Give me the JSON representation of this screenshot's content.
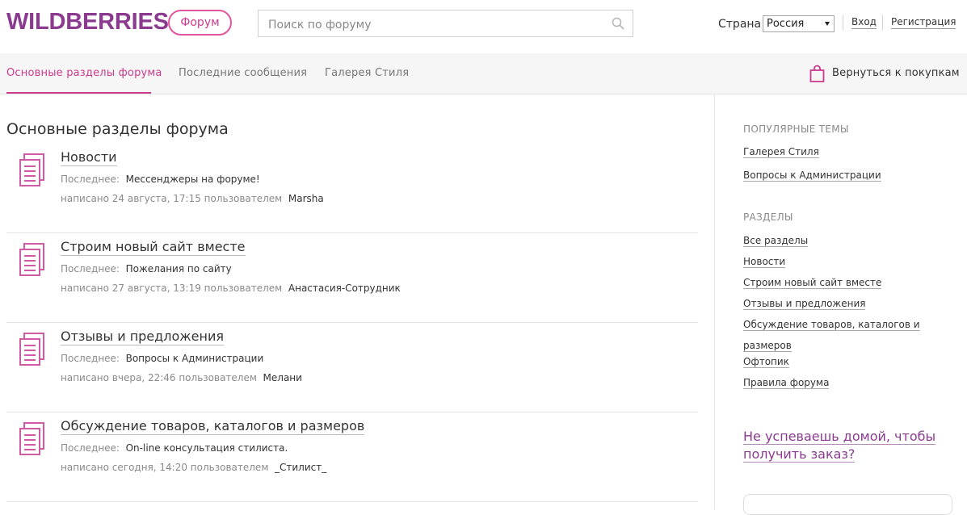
{
  "header": {
    "logo": "WILDBERRIES",
    "forum_badge": "Форум",
    "search_placeholder": "Поиск по форуму",
    "country_label": "Страна",
    "country_value": "Россия",
    "login": "Вход",
    "register": "Регистрация"
  },
  "nav": {
    "tabs": [
      "Основные разделы форума",
      "Последние сообщения",
      "Галерея Стиля"
    ],
    "back_to_shop": "Вернуться к покупкам"
  },
  "main": {
    "title": "Основные разделы форума",
    "last_label": "Последнее:",
    "topics": [
      {
        "title": "Новости",
        "last": "Мессенджеры на форуме!",
        "meta": "написано 24 августа, 17:15 пользователем",
        "user": "Marsha"
      },
      {
        "title": "Строим новый сайт вместе",
        "last": "Пожелания по сайту",
        "meta": "написано 27 августа, 13:19 пользователем",
        "user": "Анастасия-Сотрудник"
      },
      {
        "title": "Отзывы и предложения",
        "last": "Вопросы к Администрации",
        "meta": "написано вчера, 22:46 пользователем",
        "user": "Мелани"
      },
      {
        "title": "Обсуждение товаров, каталогов и размеров",
        "last": "On-line консультация стилиста.",
        "meta": "написано сегодня, 14:20 пользователем",
        "user": "_Стилист_"
      }
    ]
  },
  "sidebar": {
    "popular_heading": "ПОПУЛЯРНЫЕ ТЕМЫ",
    "popular": [
      "Галерея Стиля",
      "Вопросы к Администрации"
    ],
    "sections_heading": "РАЗДЕЛЫ",
    "sections": [
      "Все разделы",
      "Новости",
      "Строим новый сайт вместе",
      "Отзывы и предложения",
      "Обсуждение товаров, каталогов и размеров",
      "Офтопик",
      "Правила форума"
    ],
    "promo": "Не успеваешь домой, чтобы получить заказ?"
  },
  "colors": {
    "brand": "#8b3a8f",
    "accent": "#cb3a8c"
  }
}
